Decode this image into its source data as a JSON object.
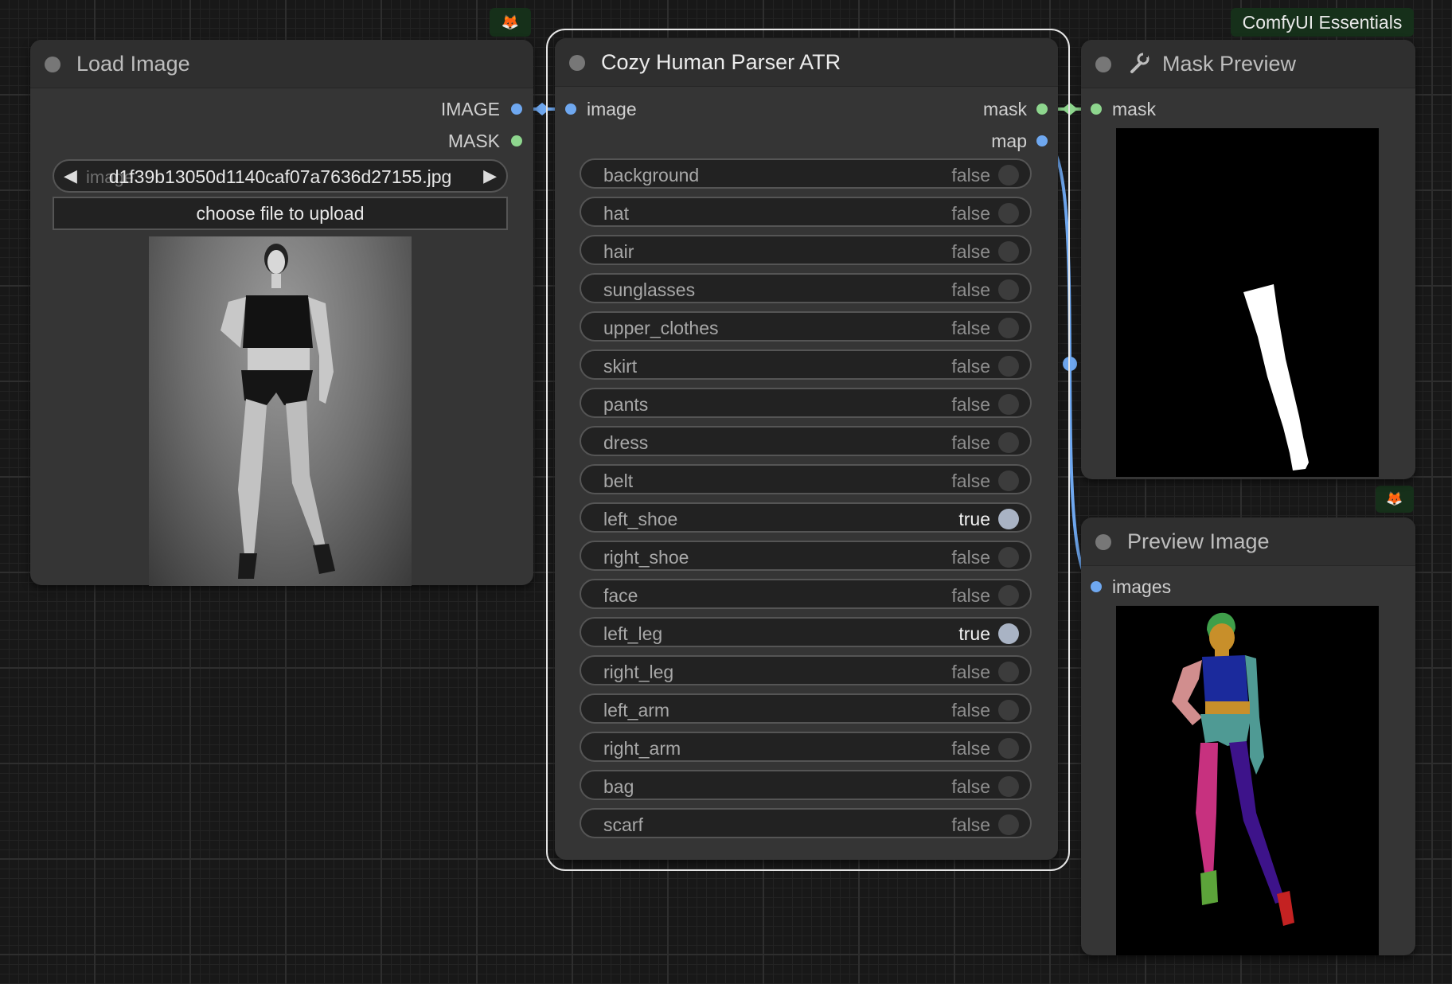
{
  "colors": {
    "canvas": "#181818",
    "node_body": "#353535",
    "node_title": "#2f2f2f",
    "image_slot": "#6fa8f0",
    "mask_slot": "#8ed68e",
    "toggle_on_knob": "#a9b3c4",
    "badge_bg": "#16301a"
  },
  "badges": {
    "essentials": "ComfyUI Essentials",
    "fox_icon": "fox-icon"
  },
  "load_image": {
    "title": "Load Image",
    "outputs": {
      "image": "IMAGE",
      "mask": "MASK"
    },
    "combo": {
      "name": "image",
      "value": "d1f39b13050d1140caf07a7636d27155.jpg"
    },
    "upload_label": "choose file to upload"
  },
  "parser": {
    "title": "Cozy Human Parser ATR",
    "input": "image",
    "outputs": {
      "mask": "mask",
      "map": "map"
    },
    "toggles": [
      {
        "name": "background",
        "value": "false"
      },
      {
        "name": "hat",
        "value": "false"
      },
      {
        "name": "hair",
        "value": "false"
      },
      {
        "name": "sunglasses",
        "value": "false"
      },
      {
        "name": "upper_clothes",
        "value": "false"
      },
      {
        "name": "skirt",
        "value": "false"
      },
      {
        "name": "pants",
        "value": "false"
      },
      {
        "name": "dress",
        "value": "false"
      },
      {
        "name": "belt",
        "value": "false"
      },
      {
        "name": "left_shoe",
        "value": "true"
      },
      {
        "name": "right_shoe",
        "value": "false"
      },
      {
        "name": "face",
        "value": "false"
      },
      {
        "name": "left_leg",
        "value": "true"
      },
      {
        "name": "right_leg",
        "value": "false"
      },
      {
        "name": "left_arm",
        "value": "false"
      },
      {
        "name": "right_arm",
        "value": "false"
      },
      {
        "name": "bag",
        "value": "false"
      },
      {
        "name": "scarf",
        "value": "false"
      }
    ]
  },
  "mask_preview": {
    "title": "Mask Preview",
    "input": "mask",
    "icon": "wrench-icon"
  },
  "preview_image": {
    "title": "Preview Image",
    "input": "images"
  }
}
